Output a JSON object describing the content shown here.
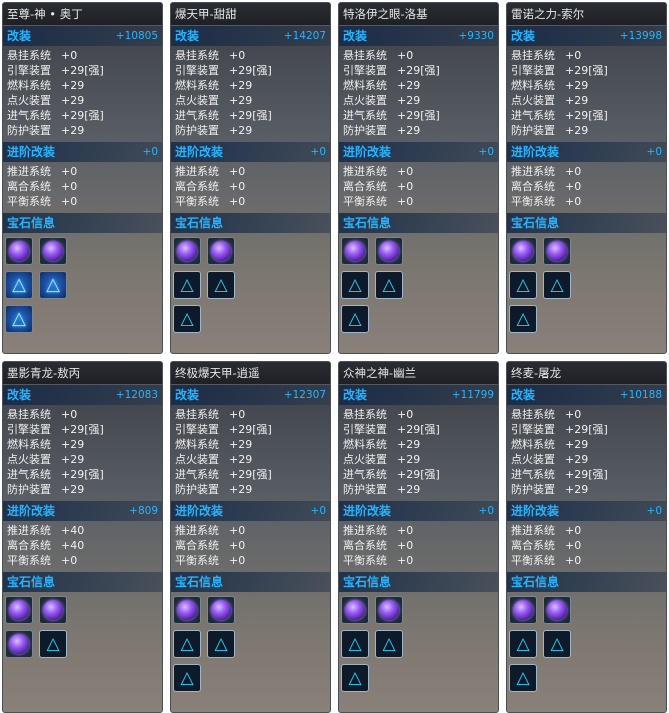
{
  "labels": {
    "mod": "改装",
    "advanced": "进阶改装",
    "gems": "宝石信息"
  },
  "cards": [
    {
      "title": "至尊-神 • 奥丁",
      "mod_total": "+10805",
      "adv_total": "+0",
      "mods": [
        {
          "k": "悬挂系统",
          "v": "+0"
        },
        {
          "k": "引擎装置",
          "v": "+29[强]"
        },
        {
          "k": "燃料系统",
          "v": "+29"
        },
        {
          "k": "点火装置",
          "v": "+29"
        },
        {
          "k": "进气系统",
          "v": "+29[强]"
        },
        {
          "k": "防护装置",
          "v": "+29"
        }
      ],
      "adv": [
        {
          "k": "推进系统",
          "v": "+0"
        },
        {
          "k": "离合系统",
          "v": "+0"
        },
        {
          "k": "平衡系统",
          "v": "+0"
        }
      ],
      "gem_slots": [
        "purple-gem",
        "purple-gem",
        "blue-triangle-gem",
        "blue-triangle-gem",
        "blue-triangle-gem"
      ]
    },
    {
      "title": "爆天甲-甜甜",
      "mod_total": "+14207",
      "adv_total": "+0",
      "mods": [
        {
          "k": "悬挂系统",
          "v": "+0"
        },
        {
          "k": "引擎装置",
          "v": "+29[强]"
        },
        {
          "k": "燃料系统",
          "v": "+29"
        },
        {
          "k": "点火装置",
          "v": "+29"
        },
        {
          "k": "进气系统",
          "v": "+29[强]"
        },
        {
          "k": "防护装置",
          "v": "+29"
        }
      ],
      "adv": [
        {
          "k": "推进系统",
          "v": "+0"
        },
        {
          "k": "离合系统",
          "v": "+0"
        },
        {
          "k": "平衡系统",
          "v": "+0"
        }
      ],
      "gem_slots": [
        "purple-gem",
        "purple-gem",
        "empty-slot",
        "empty-slot",
        "empty-slot"
      ]
    },
    {
      "title": "特洛伊之眼-洛基",
      "mod_total": "+9330",
      "adv_total": "+0",
      "mods": [
        {
          "k": "悬挂系统",
          "v": "+0"
        },
        {
          "k": "引擎装置",
          "v": "+29[强]"
        },
        {
          "k": "燃料系统",
          "v": "+29"
        },
        {
          "k": "点火装置",
          "v": "+29"
        },
        {
          "k": "进气系统",
          "v": "+29[强]"
        },
        {
          "k": "防护装置",
          "v": "+29"
        }
      ],
      "adv": [
        {
          "k": "推进系统",
          "v": "+0"
        },
        {
          "k": "离合系统",
          "v": "+0"
        },
        {
          "k": "平衡系统",
          "v": "+0"
        }
      ],
      "gem_slots": [
        "purple-gem",
        "purple-gem",
        "empty-slot",
        "empty-slot",
        "empty-slot"
      ]
    },
    {
      "title": "雷诺之力-索尔",
      "mod_total": "+13998",
      "adv_total": "+0",
      "mods": [
        {
          "k": "悬挂系统",
          "v": "+0"
        },
        {
          "k": "引擎装置",
          "v": "+29[强]"
        },
        {
          "k": "燃料系统",
          "v": "+29"
        },
        {
          "k": "点火装置",
          "v": "+29"
        },
        {
          "k": "进气系统",
          "v": "+29[强]"
        },
        {
          "k": "防护装置",
          "v": "+29"
        }
      ],
      "adv": [
        {
          "k": "推进系统",
          "v": "+0"
        },
        {
          "k": "离合系统",
          "v": "+0"
        },
        {
          "k": "平衡系统",
          "v": "+0"
        }
      ],
      "gem_slots": [
        "purple-gem",
        "purple-gem",
        "empty-slot",
        "empty-slot",
        "empty-slot"
      ]
    },
    {
      "title": "墨影青龙-敖丙",
      "mod_total": "+12083",
      "adv_total": "+809",
      "mods": [
        {
          "k": "悬挂系统",
          "v": "+0"
        },
        {
          "k": "引擎装置",
          "v": "+29[强]"
        },
        {
          "k": "燃料系统",
          "v": "+29"
        },
        {
          "k": "点火装置",
          "v": "+29"
        },
        {
          "k": "进气系统",
          "v": "+29[强]"
        },
        {
          "k": "防护装置",
          "v": "+29"
        }
      ],
      "adv": [
        {
          "k": "推进系统",
          "v": "+40"
        },
        {
          "k": "离合系统",
          "v": "+40"
        },
        {
          "k": "平衡系统",
          "v": "+0"
        }
      ],
      "gem_slots": [
        "purple-gem",
        "purple-gem",
        "purple-gem",
        "empty-slot"
      ]
    },
    {
      "title": "终极爆天甲-逍遥",
      "mod_total": "+12307",
      "adv_total": "+0",
      "mods": [
        {
          "k": "悬挂系统",
          "v": "+0"
        },
        {
          "k": "引擎装置",
          "v": "+29[强]"
        },
        {
          "k": "燃料系统",
          "v": "+29"
        },
        {
          "k": "点火装置",
          "v": "+29"
        },
        {
          "k": "进气系统",
          "v": "+29[强]"
        },
        {
          "k": "防护装置",
          "v": "+29"
        }
      ],
      "adv": [
        {
          "k": "推进系统",
          "v": "+0"
        },
        {
          "k": "离合系统",
          "v": "+0"
        },
        {
          "k": "平衡系统",
          "v": "+0"
        }
      ],
      "gem_slots": [
        "purple-gem",
        "purple-gem",
        "empty-slot",
        "empty-slot",
        "empty-slot"
      ]
    },
    {
      "title": "众神之神-幽兰",
      "mod_total": "+11799",
      "adv_total": "+0",
      "mods": [
        {
          "k": "悬挂系统",
          "v": "+0"
        },
        {
          "k": "引擎装置",
          "v": "+29[强]"
        },
        {
          "k": "燃料系统",
          "v": "+29"
        },
        {
          "k": "点火装置",
          "v": "+29"
        },
        {
          "k": "进气系统",
          "v": "+29[强]"
        },
        {
          "k": "防护装置",
          "v": "+29"
        }
      ],
      "adv": [
        {
          "k": "推进系统",
          "v": "+0"
        },
        {
          "k": "离合系统",
          "v": "+0"
        },
        {
          "k": "平衡系统",
          "v": "+0"
        }
      ],
      "gem_slots": [
        "purple-gem",
        "purple-gem",
        "empty-slot",
        "empty-slot",
        "empty-slot"
      ]
    },
    {
      "title": "终麦-屠龙",
      "mod_total": "+10188",
      "adv_total": "+0",
      "mods": [
        {
          "k": "悬挂系统",
          "v": "+0"
        },
        {
          "k": "引擎装置",
          "v": "+29[强]"
        },
        {
          "k": "燃料系统",
          "v": "+29"
        },
        {
          "k": "点火装置",
          "v": "+29"
        },
        {
          "k": "进气系统",
          "v": "+29[强]"
        },
        {
          "k": "防护装置",
          "v": "+29"
        }
      ],
      "adv": [
        {
          "k": "推进系统",
          "v": "+0"
        },
        {
          "k": "离合系统",
          "v": "+0"
        },
        {
          "k": "平衡系统",
          "v": "+0"
        }
      ],
      "gem_slots": [
        "purple-gem",
        "purple-gem",
        "empty-slot",
        "empty-slot",
        "empty-slot"
      ]
    }
  ],
  "colors": {
    "accent": "#27b4ff",
    "text": "#f0f0f0",
    "gem_purple": "#9b5cf5"
  }
}
